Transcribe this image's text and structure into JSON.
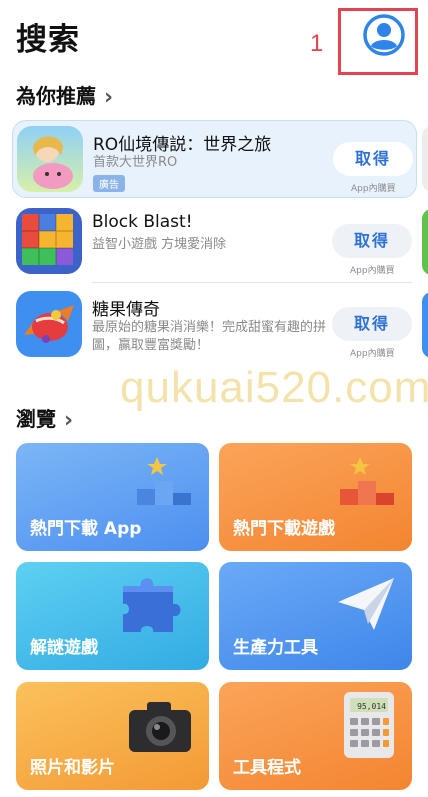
{
  "header": {
    "title": "搜索",
    "annotation_number": "1"
  },
  "recommend": {
    "title": "為你推薦",
    "apps": [
      {
        "name": "RO仙境傳説：世界之旅",
        "subtitle": "首款大世界RO",
        "badge": "廣告",
        "button": "取得",
        "iap": "App內購買"
      },
      {
        "name": "Block Blast!",
        "subtitle": "益智小遊戲 方塊愛消除",
        "button": "取得",
        "iap": "App內購買"
      },
      {
        "name": "糖果傳奇",
        "subtitle": "最原始的糖果消消樂！完成甜蜜有趣的拼圖，贏取豐富獎勵！",
        "button": "取得",
        "iap": "App內購買"
      }
    ]
  },
  "watermark": "qukuai520.com",
  "browse": {
    "title": "瀏覽",
    "tiles": [
      {
        "label": "熱門下載 App",
        "color": "#5b9ff0",
        "icon": "podium-icon"
      },
      {
        "label": "熱門下載遊戲",
        "color": "#f59440",
        "icon": "podium-icon"
      },
      {
        "label": "解謎遊戲",
        "color": "#40b8e8",
        "icon": "puzzle-icon"
      },
      {
        "label": "生產力工具",
        "color": "#4a94ec",
        "icon": "paper-plane-icon"
      },
      {
        "label": "照片和影片",
        "color": "#f6a740",
        "icon": "camera-icon"
      },
      {
        "label": "工具程式",
        "color": "#f5933e",
        "icon": "calculator-icon"
      }
    ],
    "calculator_display": "95,014"
  },
  "colors": {
    "accent": "#2e72d6",
    "annotation": "#e2454f"
  }
}
